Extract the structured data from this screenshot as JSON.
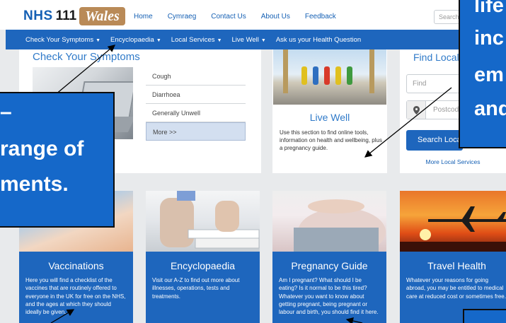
{
  "header": {
    "logo_nhs": "NHS",
    "logo_number": "111",
    "logo_wales": "Wales",
    "links": [
      "Home",
      "Cymraeg",
      "Contact Us",
      "About Us",
      "Feedback"
    ],
    "search_placeholder": "Search"
  },
  "nav": {
    "items": [
      {
        "label": "Check Your Symptoms",
        "dropdown": true
      },
      {
        "label": "Encyclopaedia",
        "dropdown": true
      },
      {
        "label": "Local Services",
        "dropdown": true
      },
      {
        "label": "Live Well",
        "dropdown": true
      },
      {
        "label": "Ask us your Health Question",
        "dropdown": false
      }
    ]
  },
  "check_symptoms": {
    "title": "Check Your Symptoms",
    "items": [
      "Cough",
      "Diarrhoea",
      "Generally Unwell",
      "More >>"
    ]
  },
  "live_well": {
    "title": "Live Well",
    "text": "Use this section to find online tools, information on health and wellbeing, plus a pregnancy guide."
  },
  "local": {
    "title": "Find Local",
    "find_placeholder": "Find",
    "postcode_placeholder": "Postcode",
    "search_button": "Search Local Services",
    "more_link": "More Local Services"
  },
  "cards": [
    {
      "title": "Vaccinations",
      "text": "Here you will find a checklist of the vaccines that are routinely offered to everyone in the UK for free on the NHS, and the ages at which they should ideally be given."
    },
    {
      "title": "Encyclopaedia",
      "text": "Visit our A-Z to find out more about illnesses, operations, tests and treatments."
    },
    {
      "title": "Pregnancy Guide",
      "text": "Am I pregnant? What should I be eating? Is it normal to be this tired? Whatever you want to know about getting pregnant, being pregnant or labour and birth, you should find it here."
    },
    {
      "title": "Travel Health",
      "text": "Whatever your reasons for going abroad, you may be entitled to medical care at reduced cost or sometimes free."
    }
  ],
  "callouts": {
    "left_lines": [
      "–",
      "range of",
      "ments."
    ],
    "right_lines": [
      "life",
      "inc",
      "em",
      "and"
    ]
  },
  "colors": {
    "brand_blue": "#1e66bd",
    "link_blue": "#1560b4",
    "title_blue": "#2f7ac9",
    "wales_tan": "#b98a57",
    "page_bg": "#e8eaec"
  }
}
